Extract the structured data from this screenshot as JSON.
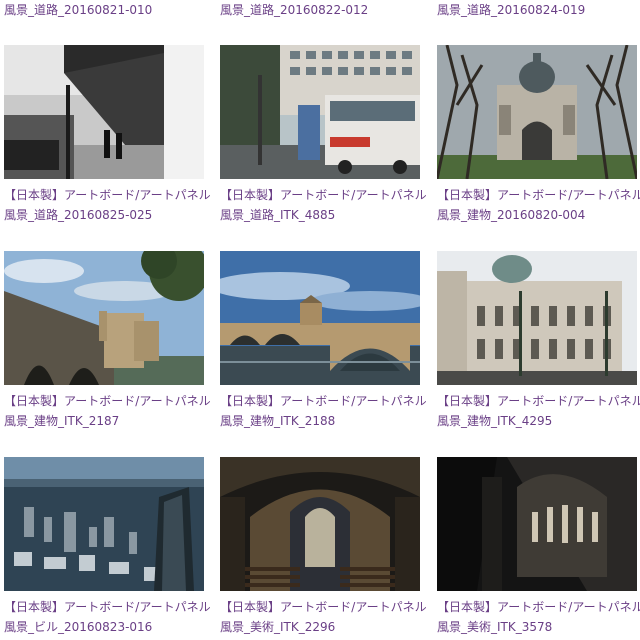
{
  "top_row": [
    {
      "title": "風景_道路_20160821-010"
    },
    {
      "title": "風景_道路_20160822-012"
    },
    {
      "title": "風景_道路_20160824-019"
    }
  ],
  "cards": [
    {
      "maker": "【日本製】アートボード/アートパネル",
      "title": "風景_道路_20160825-025",
      "image": "street-photo"
    },
    {
      "maker": "【日本製】アートボード/アートパネル",
      "title": "風景_道路_ITK_4885",
      "image": "bus-photo"
    },
    {
      "maker": "【日本製】アートボード/アートパネル",
      "title": "風景_建物_20160820-004",
      "image": "domed-building-photo"
    },
    {
      "maker": "【日本製】アートボード/アートパネル",
      "title": "風景_建物_ITK_2187",
      "image": "bridge-castle-photo"
    },
    {
      "maker": "【日本製】アートボード/アートパネル",
      "title": "風景_建物_ITK_2188",
      "image": "arch-bridge-photo"
    },
    {
      "maker": "【日本製】アートボード/アートパネル",
      "title": "風景_建物_ITK_4295",
      "image": "opera-house-photo"
    },
    {
      "maker": "【日本製】アートボード/アートパネル",
      "title": "風景_ビル_20160823-016",
      "image": "city-aerial-photo"
    },
    {
      "maker": "【日本製】アートボード/アートパネル",
      "title": "風景_美術_ITK_2296",
      "image": "church-interior-photo"
    },
    {
      "maker": "【日本製】アートボード/アートパネル",
      "title": "風景_美術_ITK_3578",
      "image": "cathedral-dark-photo"
    }
  ],
  "colors": {
    "link": "#6a3f86"
  }
}
